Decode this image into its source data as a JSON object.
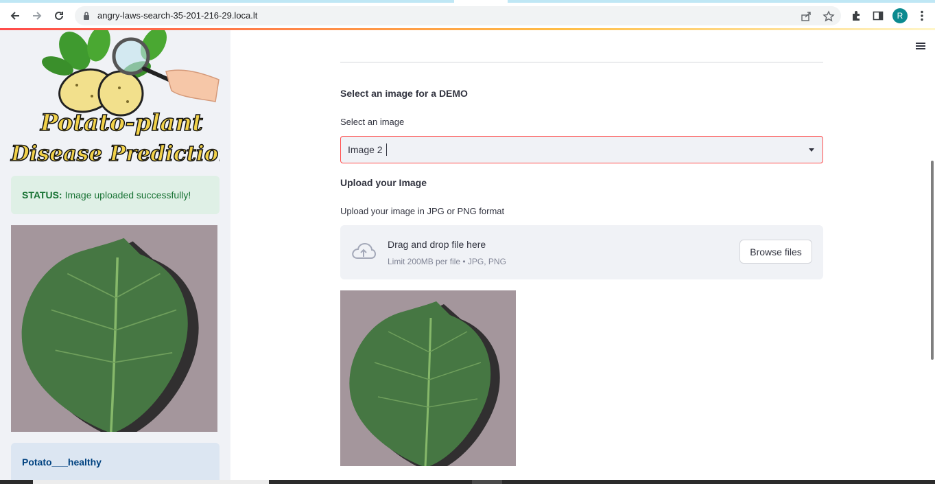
{
  "browser": {
    "url": "angry-laws-search-35-201-216-29.loca.lt",
    "profile_initial": "R",
    "icons": [
      "back-icon",
      "forward-icon",
      "reload-icon",
      "lock-icon",
      "share-icon",
      "star-icon",
      "extensions-icon",
      "side-panel-icon",
      "menu-dots-icon"
    ]
  },
  "sidebar": {
    "logo_line1": "Potato-plant",
    "logo_line2": "Disease Prediction",
    "status_label": "STATUS:",
    "status_text": "Image uploaded successfully!",
    "prediction": "Potato___healthy"
  },
  "main": {
    "demo_heading": "Select an image for a DEMO",
    "select_label": "Select an image",
    "select_value": "Image 2",
    "upload_heading": "Upload your Image",
    "upload_label": "Upload your image in JPG or PNG format",
    "dropzone_title": "Drag and drop file here",
    "dropzone_limit": "Limit 200MB per file • JPG, PNG",
    "browse_label": "Browse files"
  },
  "colors": {
    "accent": "#ff4b4b",
    "success_bg": "#dff0e6",
    "success_text": "#177233",
    "info_bg": "#dce6f2",
    "info_text": "#004280",
    "sidebar_bg": "#f0f2f6"
  }
}
